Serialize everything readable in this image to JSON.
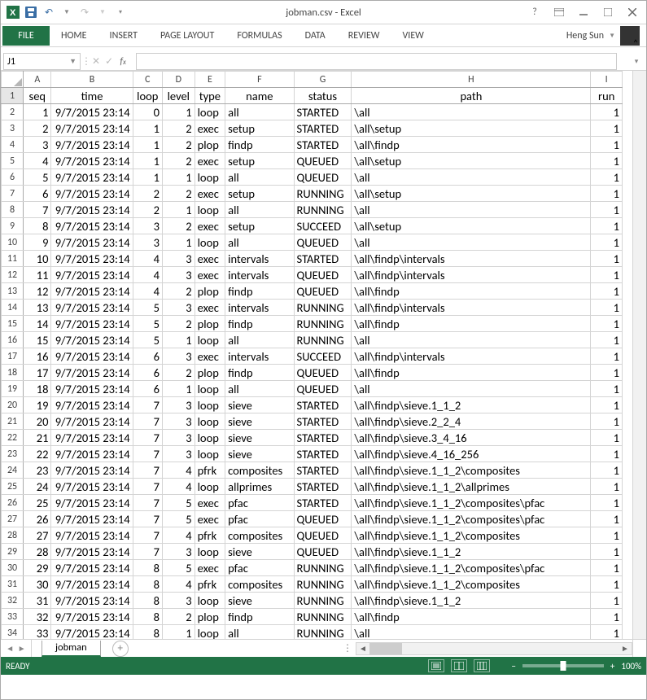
{
  "titlebar": {
    "filename": "jobman.csv",
    "app": "Excel"
  },
  "ribbon": {
    "file": "FILE",
    "tabs": [
      "HOME",
      "INSERT",
      "PAGE LAYOUT",
      "FORMULAS",
      "DATA",
      "REVIEW",
      "VIEW"
    ],
    "user": "Heng Sun"
  },
  "namebox": {
    "value": "J1"
  },
  "columns": {
    "letters": [
      "A",
      "B",
      "C",
      "D",
      "E",
      "F",
      "G",
      "H",
      "I"
    ],
    "widths": [
      33,
      96,
      35,
      38,
      36,
      81,
      68,
      282,
      37
    ],
    "headers": [
      "seq",
      "time",
      "loop",
      "level",
      "type",
      "name",
      "status",
      "path",
      "run"
    ],
    "align": [
      "right",
      "right",
      "right",
      "right",
      "left",
      "left",
      "left",
      "left",
      "right"
    ]
  },
  "rows": [
    {
      "n": 1,
      "seq": 1,
      "time": "9/7/2015 23:14",
      "loop": 0,
      "level": 1,
      "type": "loop",
      "name": "all",
      "status": "STARTED",
      "path": "\\all",
      "run": 1
    },
    {
      "n": 2,
      "seq": 2,
      "time": "9/7/2015 23:14",
      "loop": 1,
      "level": 2,
      "type": "exec",
      "name": "setup",
      "status": "STARTED",
      "path": "\\all\\setup",
      "run": 1
    },
    {
      "n": 3,
      "seq": 3,
      "time": "9/7/2015 23:14",
      "loop": 1,
      "level": 2,
      "type": "plop",
      "name": "findp",
      "status": "STARTED",
      "path": "\\all\\findp",
      "run": 1
    },
    {
      "n": 4,
      "seq": 4,
      "time": "9/7/2015 23:14",
      "loop": 1,
      "level": 2,
      "type": "exec",
      "name": "setup",
      "status": "QUEUED",
      "path": "\\all\\setup",
      "run": 1
    },
    {
      "n": 5,
      "seq": 5,
      "time": "9/7/2015 23:14",
      "loop": 1,
      "level": 1,
      "type": "loop",
      "name": "all",
      "status": "QUEUED",
      "path": "\\all",
      "run": 1
    },
    {
      "n": 6,
      "seq": 6,
      "time": "9/7/2015 23:14",
      "loop": 2,
      "level": 2,
      "type": "exec",
      "name": "setup",
      "status": "RUNNING",
      "path": "\\all\\setup",
      "run": 1
    },
    {
      "n": 7,
      "seq": 7,
      "time": "9/7/2015 23:14",
      "loop": 2,
      "level": 1,
      "type": "loop",
      "name": "all",
      "status": "RUNNING",
      "path": "\\all",
      "run": 1
    },
    {
      "n": 8,
      "seq": 8,
      "time": "9/7/2015 23:14",
      "loop": 3,
      "level": 2,
      "type": "exec",
      "name": "setup",
      "status": "SUCCEED",
      "path": "\\all\\setup",
      "run": 1
    },
    {
      "n": 9,
      "seq": 9,
      "time": "9/7/2015 23:14",
      "loop": 3,
      "level": 1,
      "type": "loop",
      "name": "all",
      "status": "QUEUED",
      "path": "\\all",
      "run": 1
    },
    {
      "n": 10,
      "seq": 10,
      "time": "9/7/2015 23:14",
      "loop": 4,
      "level": 3,
      "type": "exec",
      "name": "intervals",
      "status": "STARTED",
      "path": "\\all\\findp\\intervals",
      "run": 1
    },
    {
      "n": 11,
      "seq": 11,
      "time": "9/7/2015 23:14",
      "loop": 4,
      "level": 3,
      "type": "exec",
      "name": "intervals",
      "status": "QUEUED",
      "path": "\\all\\findp\\intervals",
      "run": 1
    },
    {
      "n": 12,
      "seq": 12,
      "time": "9/7/2015 23:14",
      "loop": 4,
      "level": 2,
      "type": "plop",
      "name": "findp",
      "status": "QUEUED",
      "path": "\\all\\findp",
      "run": 1
    },
    {
      "n": 13,
      "seq": 13,
      "time": "9/7/2015 23:14",
      "loop": 5,
      "level": 3,
      "type": "exec",
      "name": "intervals",
      "status": "RUNNING",
      "path": "\\all\\findp\\intervals",
      "run": 1
    },
    {
      "n": 14,
      "seq": 14,
      "time": "9/7/2015 23:14",
      "loop": 5,
      "level": 2,
      "type": "plop",
      "name": "findp",
      "status": "RUNNING",
      "path": "\\all\\findp",
      "run": 1
    },
    {
      "n": 15,
      "seq": 15,
      "time": "9/7/2015 23:14",
      "loop": 5,
      "level": 1,
      "type": "loop",
      "name": "all",
      "status": "RUNNING",
      "path": "\\all",
      "run": 1
    },
    {
      "n": 16,
      "seq": 16,
      "time": "9/7/2015 23:14",
      "loop": 6,
      "level": 3,
      "type": "exec",
      "name": "intervals",
      "status": "SUCCEED",
      "path": "\\all\\findp\\intervals",
      "run": 1
    },
    {
      "n": 17,
      "seq": 17,
      "time": "9/7/2015 23:14",
      "loop": 6,
      "level": 2,
      "type": "plop",
      "name": "findp",
      "status": "QUEUED",
      "path": "\\all\\findp",
      "run": 1
    },
    {
      "n": 18,
      "seq": 18,
      "time": "9/7/2015 23:14",
      "loop": 6,
      "level": 1,
      "type": "loop",
      "name": "all",
      "status": "QUEUED",
      "path": "\\all",
      "run": 1
    },
    {
      "n": 19,
      "seq": 19,
      "time": "9/7/2015 23:14",
      "loop": 7,
      "level": 3,
      "type": "loop",
      "name": "sieve",
      "status": "STARTED",
      "path": "\\all\\findp\\sieve.1_1_2",
      "run": 1
    },
    {
      "n": 20,
      "seq": 20,
      "time": "9/7/2015 23:14",
      "loop": 7,
      "level": 3,
      "type": "loop",
      "name": "sieve",
      "status": "STARTED",
      "path": "\\all\\findp\\sieve.2_2_4",
      "run": 1
    },
    {
      "n": 21,
      "seq": 21,
      "time": "9/7/2015 23:14",
      "loop": 7,
      "level": 3,
      "type": "loop",
      "name": "sieve",
      "status": "STARTED",
      "path": "\\all\\findp\\sieve.3_4_16",
      "run": 1
    },
    {
      "n": 22,
      "seq": 22,
      "time": "9/7/2015 23:14",
      "loop": 7,
      "level": 3,
      "type": "loop",
      "name": "sieve",
      "status": "STARTED",
      "path": "\\all\\findp\\sieve.4_16_256",
      "run": 1
    },
    {
      "n": 23,
      "seq": 23,
      "time": "9/7/2015 23:14",
      "loop": 7,
      "level": 4,
      "type": "pfrk",
      "name": "composites",
      "status": "STARTED",
      "path": "\\all\\findp\\sieve.1_1_2\\composites",
      "run": 1
    },
    {
      "n": 24,
      "seq": 24,
      "time": "9/7/2015 23:14",
      "loop": 7,
      "level": 4,
      "type": "loop",
      "name": "allprimes",
      "status": "STARTED",
      "path": "\\all\\findp\\sieve.1_1_2\\allprimes",
      "run": 1
    },
    {
      "n": 25,
      "seq": 25,
      "time": "9/7/2015 23:14",
      "loop": 7,
      "level": 5,
      "type": "exec",
      "name": "pfac",
      "status": "STARTED",
      "path": "\\all\\findp\\sieve.1_1_2\\composites\\pfac",
      "run": 1
    },
    {
      "n": 26,
      "seq": 26,
      "time": "9/7/2015 23:14",
      "loop": 7,
      "level": 5,
      "type": "exec",
      "name": "pfac",
      "status": "QUEUED",
      "path": "\\all\\findp\\sieve.1_1_2\\composites\\pfac",
      "run": 1
    },
    {
      "n": 27,
      "seq": 27,
      "time": "9/7/2015 23:14",
      "loop": 7,
      "level": 4,
      "type": "pfrk",
      "name": "composites",
      "status": "QUEUED",
      "path": "\\all\\findp\\sieve.1_1_2\\composites",
      "run": 1
    },
    {
      "n": 28,
      "seq": 28,
      "time": "9/7/2015 23:14",
      "loop": 7,
      "level": 3,
      "type": "loop",
      "name": "sieve",
      "status": "QUEUED",
      "path": "\\all\\findp\\sieve.1_1_2",
      "run": 1
    },
    {
      "n": 29,
      "seq": 29,
      "time": "9/7/2015 23:14",
      "loop": 8,
      "level": 5,
      "type": "exec",
      "name": "pfac",
      "status": "RUNNING",
      "path": "\\all\\findp\\sieve.1_1_2\\composites\\pfac",
      "run": 1
    },
    {
      "n": 30,
      "seq": 30,
      "time": "9/7/2015 23:14",
      "loop": 8,
      "level": 4,
      "type": "pfrk",
      "name": "composites",
      "status": "RUNNING",
      "path": "\\all\\findp\\sieve.1_1_2\\composites",
      "run": 1
    },
    {
      "n": 31,
      "seq": 31,
      "time": "9/7/2015 23:14",
      "loop": 8,
      "level": 3,
      "type": "loop",
      "name": "sieve",
      "status": "RUNNING",
      "path": "\\all\\findp\\sieve.1_1_2",
      "run": 1
    },
    {
      "n": 32,
      "seq": 32,
      "time": "9/7/2015 23:14",
      "loop": 8,
      "level": 2,
      "type": "plop",
      "name": "findp",
      "status": "RUNNING",
      "path": "\\all\\findp",
      "run": 1
    },
    {
      "n": 33,
      "seq": 33,
      "time": "9/7/2015 23:14",
      "loop": 8,
      "level": 1,
      "type": "loop",
      "name": "all",
      "status": "RUNNING",
      "path": "\\all",
      "run": 1
    }
  ],
  "sheets": {
    "active": "jobman"
  },
  "status": {
    "mode": "READY",
    "zoom": "100%"
  }
}
